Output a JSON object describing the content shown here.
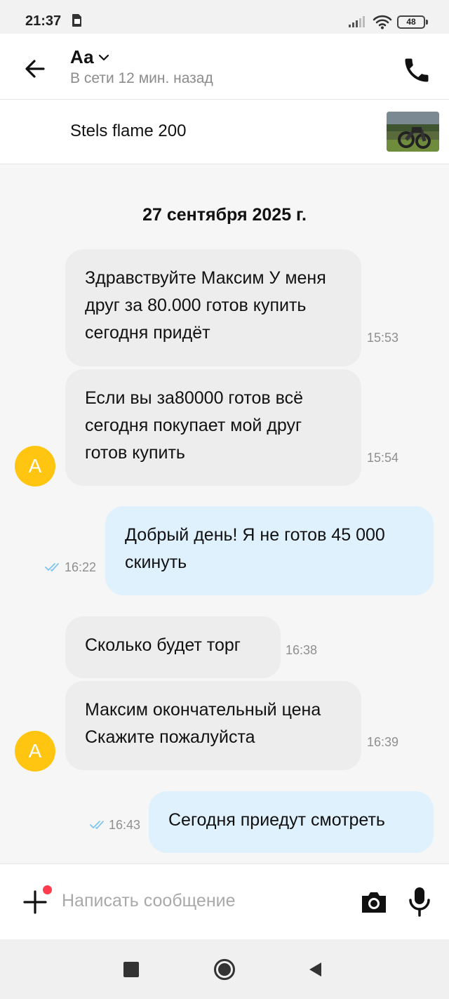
{
  "status_bar": {
    "time": "21:37",
    "battery": "48"
  },
  "header": {
    "contact_name": "Аа",
    "contact_status": "В сети 12 мин. назад"
  },
  "listing": {
    "title": "Stels flame 200"
  },
  "chat": {
    "date": "27 сентября 2025 г.",
    "avatar_letter": "А",
    "messages": [
      {
        "direction": "in",
        "text": "Здравствуйте Максим У меня друг за 80.000 готов купить сегодня придёт",
        "time": "15:53"
      },
      {
        "direction": "in",
        "text": "Если вы за80000 готов всё сегодня покупает мой друг готов купить",
        "time": "15:54"
      },
      {
        "direction": "out",
        "text": "Добрый день! Я не готов 45 000 скинуть",
        "time": "16:22",
        "read": true
      },
      {
        "direction": "in",
        "text": "Сколько будет торг",
        "time": "16:38"
      },
      {
        "direction": "in",
        "text": "Максим окончательный цена Скажите пожалуйста",
        "time": "16:39"
      },
      {
        "direction": "out",
        "text": "Сегодня приедут смотреть",
        "time": "16:43",
        "read": true
      }
    ]
  },
  "composer": {
    "placeholder": "Написать сообщение"
  },
  "colors": {
    "incoming_bubble": "#ededed",
    "outgoing_bubble": "#dff1fd",
    "avatar": "#ffc510",
    "read_checks": "#7fc4ef",
    "notify_dot": "#ff3b4e"
  },
  "icons": {
    "back": "arrow-left-icon",
    "phone": "phone-icon",
    "plus": "plus-icon",
    "camera": "camera-icon",
    "mic": "microphone-icon",
    "chevron": "chevron-down-icon"
  }
}
